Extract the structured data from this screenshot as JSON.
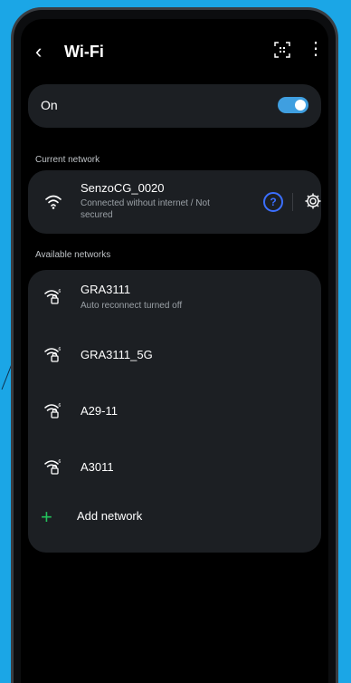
{
  "header": {
    "title": "Wi-Fi",
    "back_icon": "back-arrow-icon",
    "qr_icon": "qr-code-icon",
    "more_icon": "more-options-icon"
  },
  "wifi_toggle": {
    "label": "On",
    "state": "on",
    "accent": "#3f9fe0"
  },
  "current": {
    "section_label": "Current network",
    "name": "SenzoCG_0020",
    "status_line1": "Connected without internet / Not",
    "status_line2": "secured"
  },
  "available": {
    "section_label": "Available networks",
    "networks": [
      {
        "name": "GRA3111",
        "sub": "Auto reconnect turned off"
      },
      {
        "name": "GRA3111_5G",
        "sub": ""
      },
      {
        "name": "A29-11",
        "sub": ""
      },
      {
        "name": "A3011",
        "sub": ""
      }
    ],
    "add_label": "Add network"
  },
  "colors": {
    "background": "#1ba6e6",
    "card": "#1c1f23",
    "help_accent": "#3b6fff",
    "add_accent": "#22c25b"
  }
}
